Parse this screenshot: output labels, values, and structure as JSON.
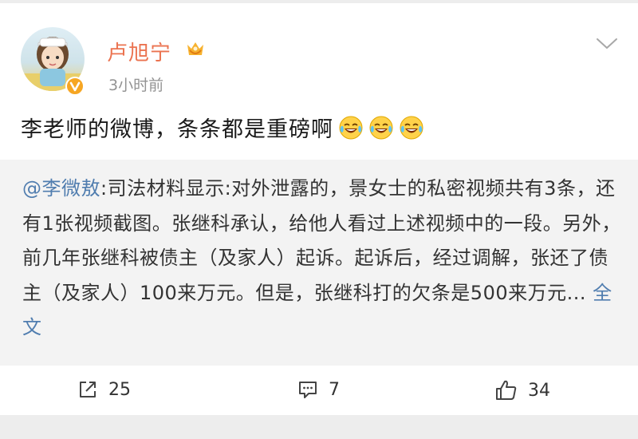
{
  "post": {
    "user": {
      "name": "卢旭宁",
      "avatar_badge": "v"
    },
    "time": "3小时前",
    "text": "李老师的微博，条条都是重磅啊",
    "emojis": [
      "laugh-cry-emoji",
      "laugh-cry-emoji",
      "laugh-cry-emoji"
    ]
  },
  "repost": {
    "mention": "@李微敖",
    "text": ":司法材料显示:对外泄露的，景女士的私密视频共有3条，还有1张视频截图。张继科承认，给他人看过上述视频中的一段。另外，前几年张继科被债主（及家人）起诉。起诉后，经过调解，张还了债主（及家人）100来万元。但是，张继科打的欠条是500来万元...",
    "full_text_link": " 全文"
  },
  "actions": {
    "share_count": "25",
    "comment_count": "7",
    "like_count": "34"
  },
  "colors": {
    "username": "#eb7350",
    "link": "#507daf",
    "repost_bg": "#f3f3f3",
    "page_bg": "#ededed"
  }
}
